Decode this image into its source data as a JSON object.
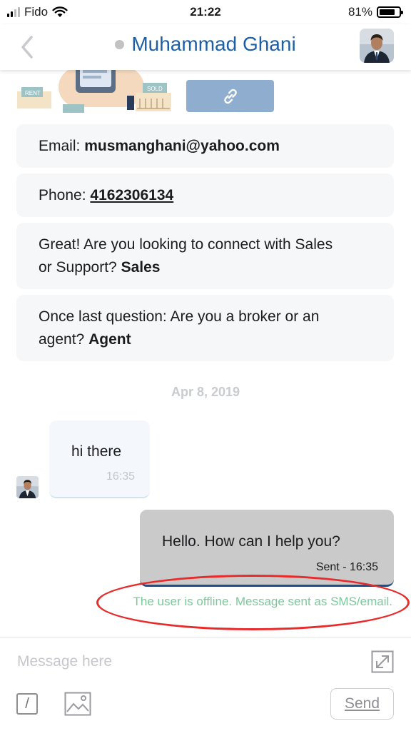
{
  "status_bar": {
    "carrier": "Fido",
    "time": "21:22",
    "battery_percent": "81%",
    "battery_level": 0.81,
    "signal_bars": 2
  },
  "header": {
    "title": "Muhammad Ghani",
    "presence": "offline",
    "back_icon": "chevron-left-icon",
    "avatar_icon": "user-avatar"
  },
  "attachment": {
    "link_icon": "link-icon",
    "illustration_labels": {
      "rent": "RENT",
      "sold": "SOLD"
    }
  },
  "info_cards": {
    "email_label": "Email: ",
    "email_value": "musmanghani@yahoo.com",
    "phone_label": "Phone: ",
    "phone_value": "4162306134",
    "q1_text_line1": "Great! Are you looking to connect with Sales",
    "q1_text_line2": "or Support? ",
    "q1_answer": "Sales",
    "q2_text_line1": "Once last question: Are you a broker or an",
    "q2_text_line2": "agent? ",
    "q2_answer": "Agent"
  },
  "date_separator": "Apr 8, 2019",
  "messages": {
    "incoming_text": "hi there",
    "incoming_time": "16:35",
    "outgoing_text": "Hello. How can I help you?",
    "outgoing_time": "Sent - 16:35"
  },
  "offline_note": "The user is offline. Message sent as SMS/email.",
  "composer": {
    "placeholder": "Message here",
    "send_label": "Send",
    "command_glyph": "/"
  },
  "colors": {
    "accent": "#1f5fa6",
    "link_button": "#8eadcf",
    "offline_note": "#7bc99b",
    "annotation_ring": "#e82a2a",
    "outgoing_bubble": "#cacaca"
  }
}
